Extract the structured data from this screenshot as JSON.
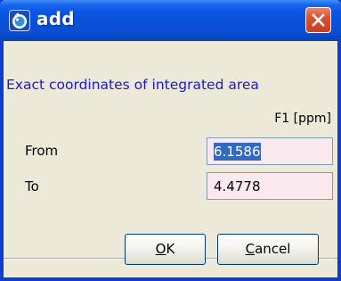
{
  "window": {
    "title": "add",
    "icon": "app-icon",
    "close_icon": "close-icon"
  },
  "form": {
    "heading": "Exact coordinates of integrated area",
    "column_header": "F1 [ppm]",
    "rows": [
      {
        "label": "From",
        "value": "6.1586",
        "selected": true
      },
      {
        "label": "To",
        "value": "4.4778",
        "selected": false
      }
    ]
  },
  "buttons": {
    "ok": {
      "mnemonic": "O",
      "rest": "K",
      "label": "OK"
    },
    "cancel": {
      "mnemonic": "C",
      "rest": "ancel",
      "label": "Cancel"
    }
  },
  "colors": {
    "title_bar": "#0a55e4",
    "heading_text": "#1c1cc8",
    "field_background": "#fce8ef",
    "selection": "#316ac5",
    "close_button": "#d9522e",
    "dialog_background": "#ece9d8"
  }
}
